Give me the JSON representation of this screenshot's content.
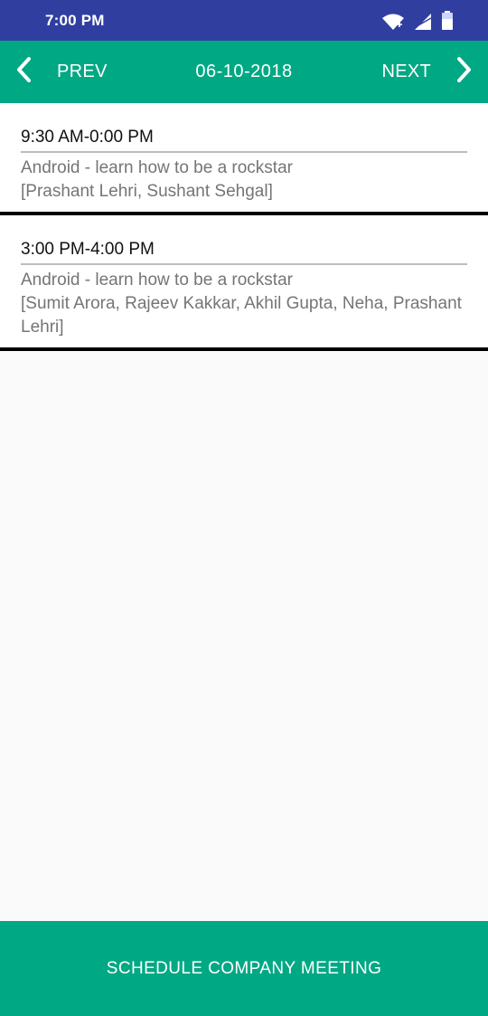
{
  "status_bar": {
    "time": "7:00 PM",
    "icons": [
      "wifi-icon",
      "signal-icon",
      "battery-icon"
    ]
  },
  "toolbar": {
    "prev_label": "PREV",
    "date": "06-10-2018",
    "next_label": "NEXT",
    "icons": [
      "chevron-left-icon",
      "chevron-right-icon"
    ]
  },
  "meetings": [
    {
      "time": "9:30 AM-0:00 PM",
      "title": "Android - learn how to be a rockstar",
      "attendees": "[Prashant Lehri, Sushant Sehgal]"
    },
    {
      "time": "3:00 PM-4:00 PM",
      "title": "Android - learn how to be a rockstar",
      "attendees": "[Sumit Arora, Rajeev Kakkar, Akhil Gupta, Neha, Prashant Lehri]"
    }
  ],
  "bottom_button": {
    "label": "SCHEDULE COMPANY MEETING"
  },
  "colors": {
    "status_bar": "#303f9f",
    "accent": "#00a884",
    "background": "#fafafa",
    "divider": "#000000"
  }
}
